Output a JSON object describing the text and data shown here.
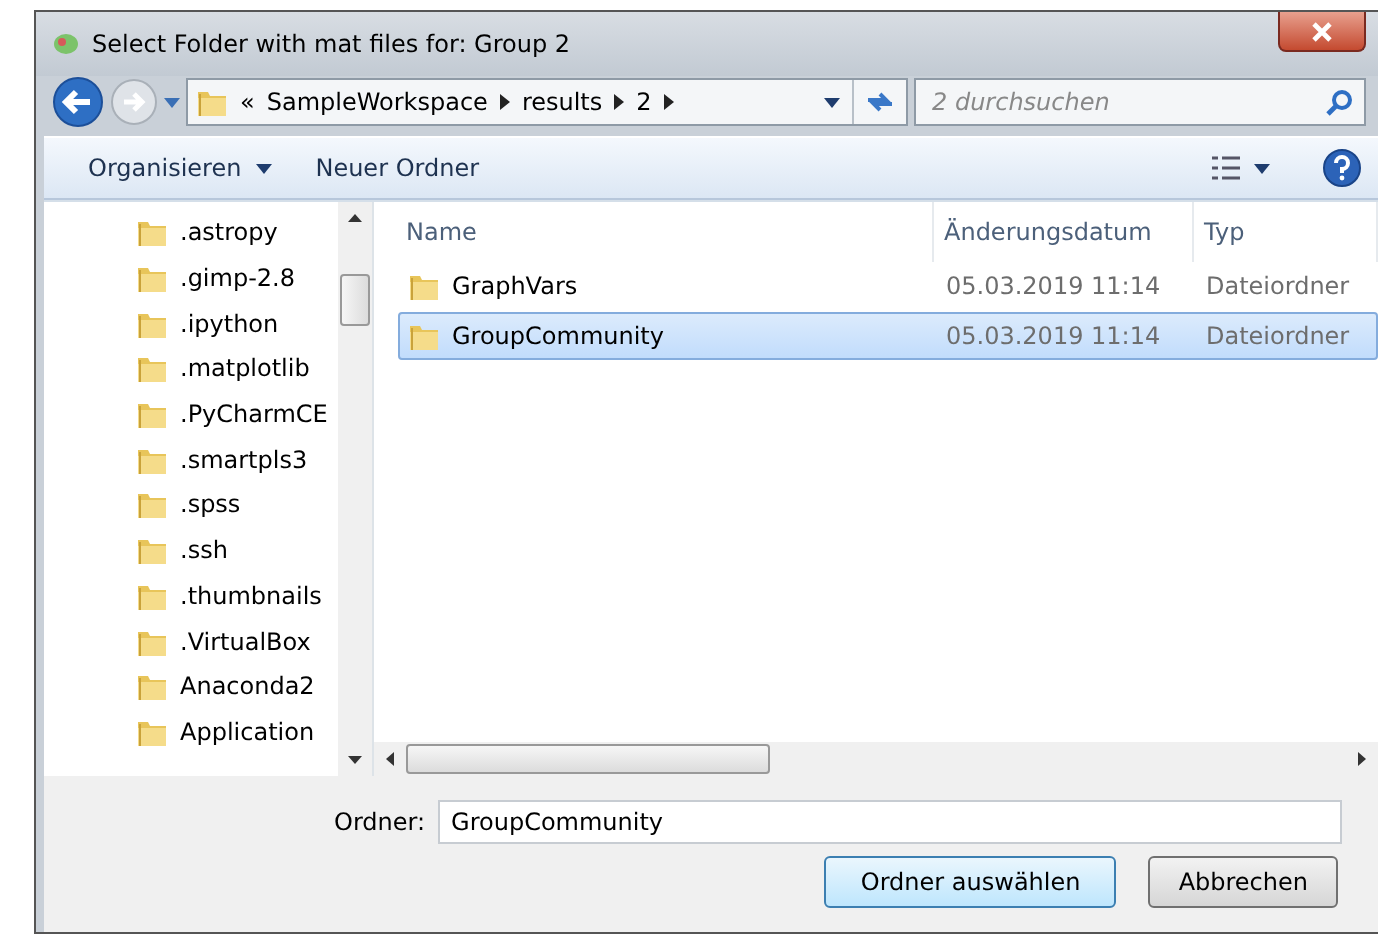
{
  "window": {
    "title": "Select Folder with mat files for: Group 2"
  },
  "address": {
    "overflow": "«",
    "crumbs": [
      "SampleWorkspace",
      "results",
      "2"
    ]
  },
  "search": {
    "placeholder": "2 durchsuchen"
  },
  "toolbar": [
    {
      "label": "Organisieren",
      "dropdown": true
    },
    {
      "label": "Neuer Ordner",
      "dropdown": false
    }
  ],
  "nav": {
    "items": [
      ".astropy",
      ".gimp-2.8",
      ".ipython",
      ".matplotlib",
      ".PyCharmCE",
      ".smartpls3",
      ".spss",
      ".ssh",
      ".thumbnails",
      ".VirtualBox",
      "Anaconda2",
      "Application"
    ]
  },
  "table": {
    "columns": [
      "Name",
      "Änderungsdatum",
      "Typ"
    ],
    "rows": [
      {
        "name": "GraphVars",
        "date": "05.03.2019 11:14",
        "type": "Dateiordner",
        "selected": false
      },
      {
        "name": "GroupCommunity",
        "date": "05.03.2019 11:14",
        "type": "Dateiordner",
        "selected": true
      }
    ]
  },
  "folder_field": {
    "label": "Ordner:",
    "value": "GroupCommunity"
  },
  "buttons": [
    {
      "label": "Ordner auswählen",
      "default": true
    },
    {
      "label": "Abbrechen",
      "default": false
    }
  ]
}
